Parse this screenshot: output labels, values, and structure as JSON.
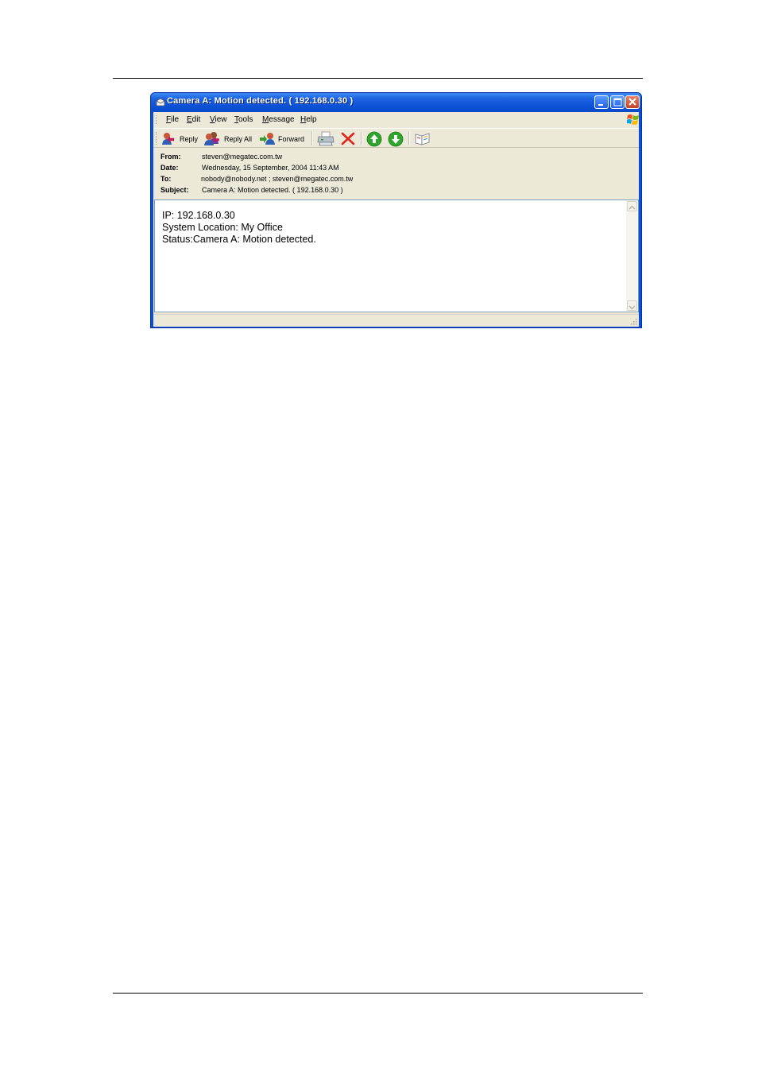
{
  "window": {
    "title": "Camera A: Motion detected. ( 192.168.0.30 )"
  },
  "menu": [
    {
      "label": "File",
      "accel": "F",
      "rest": "ile"
    },
    {
      "label": "Edit",
      "accel": "E",
      "rest": "dit"
    },
    {
      "label": "View",
      "accel": "V",
      "rest": "iew"
    },
    {
      "label": "Tools",
      "accel": "T",
      "rest": "ools"
    },
    {
      "label": "Message",
      "accel": "M",
      "rest": "essage"
    },
    {
      "label": "Help",
      "accel": "H",
      "rest": "elp"
    }
  ],
  "toolbar": {
    "reply_label": "Reply",
    "reply_all_label": "Reply All",
    "forward_label": "Forward",
    "icons": [
      "reply-icon",
      "reply-all-icon",
      "forward-icon",
      "print-icon",
      "delete-icon",
      "previous-icon",
      "next-icon",
      "addresses-icon"
    ]
  },
  "headers": {
    "from_label": "From:",
    "from_value": "steven@megatec.com.tw",
    "date_label": "Date:",
    "date_value": "Wednesday, 15 September, 2004 11:43 AM",
    "to_label": "To:",
    "to_value": "nobody@nobody.net ; steven@megatec.com.tw",
    "subject_label": "Subject:",
    "subject_value": "Camera A: Motion detected. ( 192.168.0.30 )"
  },
  "message": {
    "lines": [
      "IP: 192.168.0.30",
      "System Location: My Office",
      "Status:Camera A: Motion detected."
    ]
  },
  "colors": {
    "titlebar": "#0a52d8",
    "chrome": "#ece9d8",
    "close_button": "#d2552f"
  }
}
